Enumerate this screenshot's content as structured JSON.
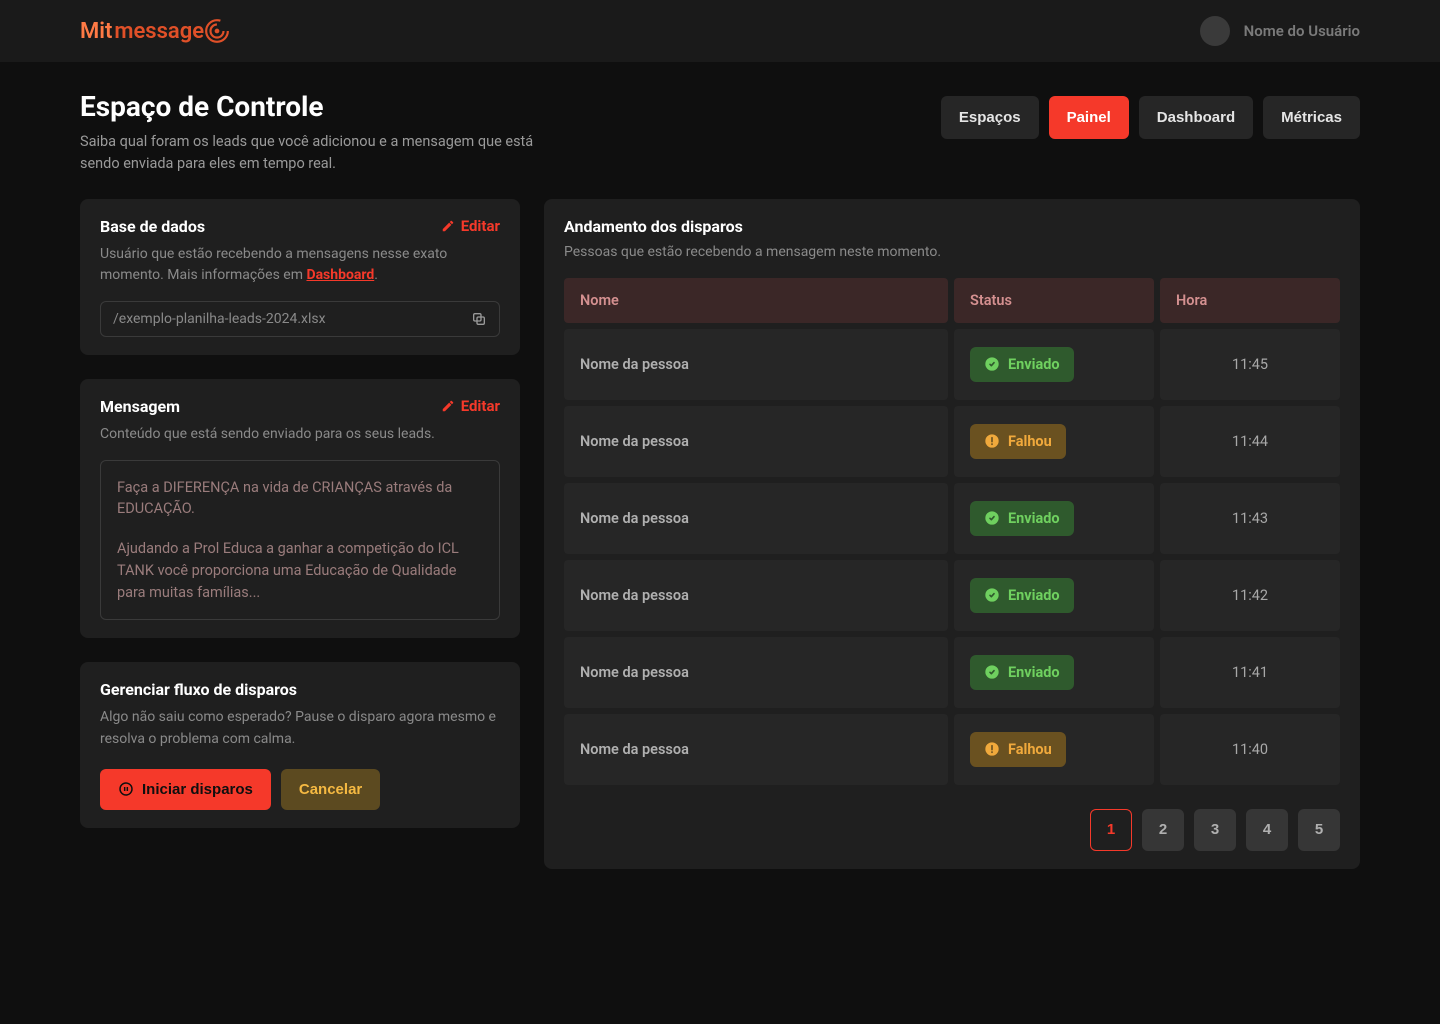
{
  "brand": {
    "part1": "Mit",
    "part2": "message"
  },
  "user": {
    "name": "Nome do Usuário"
  },
  "page": {
    "title": "Espaço de Controle",
    "subtitle": "Saiba qual foram os leads que você adicionou e a mensagem que está sendo enviada para eles em tempo real."
  },
  "tabs": {
    "espacos": "Espaços",
    "painel": "Painel",
    "dashboard": "Dashboard",
    "metricas": "Métricas"
  },
  "base": {
    "title": "Base de dados",
    "edit": "Editar",
    "desc_pre": "Usuário que estão recebendo a mensagens nesse exato momento. Mais informações em ",
    "desc_link": "Dashboard",
    "desc_post": ".",
    "file": "/exemplo-planilha-leads-2024.xlsx"
  },
  "message": {
    "title": "Mensagem",
    "edit": "Editar",
    "desc": "Conteúdo que está sendo enviado para os seus leads.",
    "p1": "Faça a DIFERENÇA na vida de CRIANÇAS através da EDUCAÇÃO.",
    "p2": "Ajudando a Prol Educa a ganhar a competição do ICL TANK você proporciona uma Educação de Qualidade para muitas famílias..."
  },
  "flow": {
    "title": "Gerenciar fluxo de disparos",
    "desc": "Algo não saiu como esperado? Pause o disparo agora mesmo e resolva o problema com calma.",
    "start": "Iniciar disparos",
    "cancel": "Cancelar"
  },
  "progress": {
    "title": "Andamento dos disparos",
    "desc": "Pessoas que estão recebendo a mensagem neste momento.",
    "cols": {
      "name": "Nome",
      "status": "Status",
      "time": "Hora"
    },
    "status_labels": {
      "sent": "Enviado",
      "failed": "Falhou"
    },
    "rows": [
      {
        "name": "Nome da pessoa",
        "status": "sent",
        "time": "11:45"
      },
      {
        "name": "Nome da pessoa",
        "status": "failed",
        "time": "11:44"
      },
      {
        "name": "Nome da pessoa",
        "status": "sent",
        "time": "11:43"
      },
      {
        "name": "Nome da pessoa",
        "status": "sent",
        "time": "11:42"
      },
      {
        "name": "Nome da pessoa",
        "status": "sent",
        "time": "11:41"
      },
      {
        "name": "Nome da pessoa",
        "status": "failed",
        "time": "11:40"
      }
    ],
    "pages": [
      "1",
      "2",
      "3",
      "4",
      "5"
    ],
    "active_page": "1"
  }
}
